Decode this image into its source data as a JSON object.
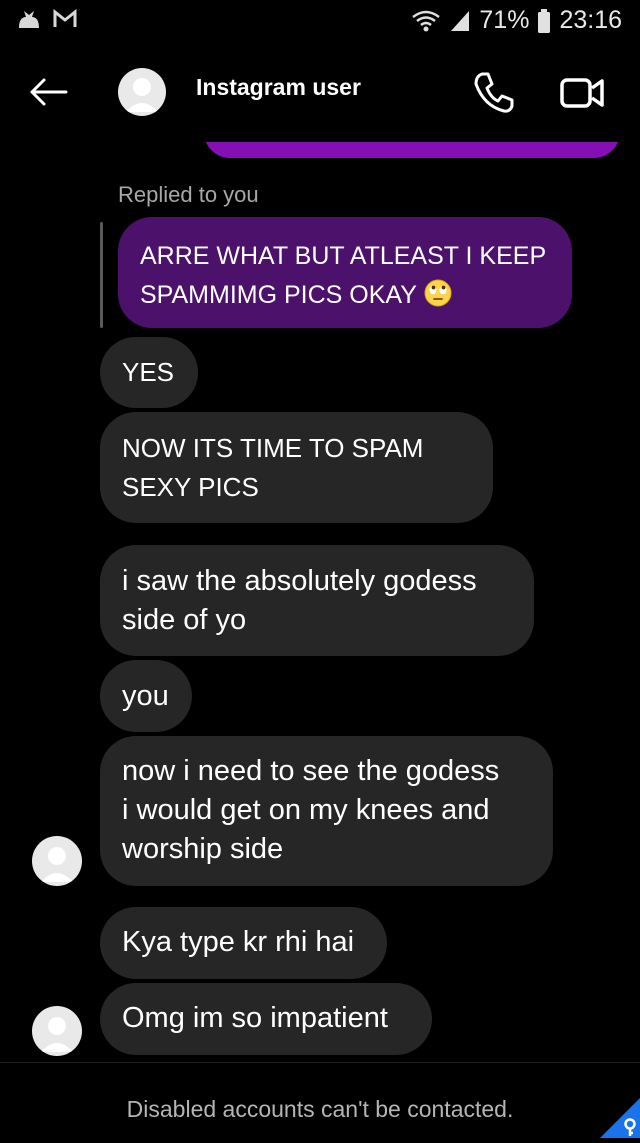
{
  "status_bar": {
    "notification_icons": [
      "cat-icon",
      "gmail-icon"
    ],
    "battery_percent": "71%",
    "time": "23:16"
  },
  "header": {
    "title": "Instagram user",
    "icons": [
      "back-arrow-icon",
      "avatar-icon",
      "phone-icon",
      "video-camera-icon"
    ]
  },
  "conversation": {
    "reply_label": "Replied to you",
    "replied_message": {
      "line1": "ARRE WHAT BUT ATLEAST I KEEP",
      "line2": "SPAMMIMG PICS OKAY",
      "emoji": "eye-roll-emoji"
    },
    "messages": [
      {
        "lines": [
          "YES"
        ]
      },
      {
        "lines": [
          "NOW ITS TIME TO SPAM",
          "SEXY PICS"
        ]
      },
      {
        "lines": [
          "i saw the absolutely godess",
          "side of yo"
        ]
      },
      {
        "lines": [
          "you"
        ]
      },
      {
        "lines": [
          "now i need to see the godess",
          "i would get on my knees and",
          "worship side"
        ]
      },
      {
        "lines": [
          "Kya type kr rhi hai"
        ]
      },
      {
        "lines": [
          "Omg im so impatient"
        ]
      }
    ]
  },
  "footer": {
    "notice": "Disabled accounts can't be contacted."
  },
  "colors": {
    "background": "#000000",
    "incoming_bubble": "#262626",
    "outgoing_bubble": "#4c126b",
    "accent_purple": "#8410b5",
    "badge": "#1a73e8"
  }
}
